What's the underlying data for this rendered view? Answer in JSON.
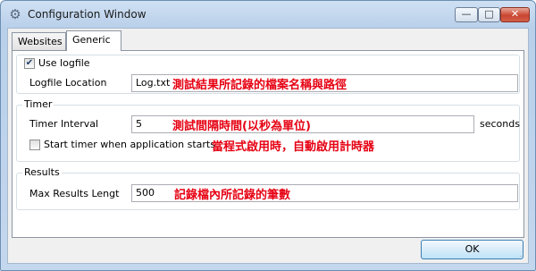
{
  "window": {
    "title": "Configuration Window",
    "app_icon": "gear-icon",
    "caption_buttons": {
      "minimize": "—",
      "maximize": "□",
      "close": "✕"
    }
  },
  "tabs": [
    {
      "label": "Websites",
      "selected": false
    },
    {
      "label": "Generic",
      "selected": true
    }
  ],
  "logfile": {
    "use_logfile_label": "Use logfile",
    "use_logfile_checked": true,
    "location_label": "Logfile Location",
    "location_value": "Log.txt",
    "annotation": "測試結果所記錄的檔案名稱與路徑"
  },
  "timer": {
    "group_title": "Timer",
    "interval_label": "Timer Interval",
    "interval_value": "5",
    "interval_annotation": "測試間隔時間(以秒為單位)",
    "interval_unit": "seconds",
    "start_label": "Start timer when application starts",
    "start_checked": false,
    "start_annotation": "當程式啟用時，自動啟用計時器"
  },
  "results": {
    "group_title": "Results",
    "max_label": "Max Results Lengt",
    "max_value": "500",
    "annotation": "記錄檔內所記錄的筆數"
  },
  "ok_label": "OK",
  "colors": {
    "annotation_red": "#e60012",
    "title_bar": "#c3d7ee",
    "close_button": "#c9452f"
  }
}
